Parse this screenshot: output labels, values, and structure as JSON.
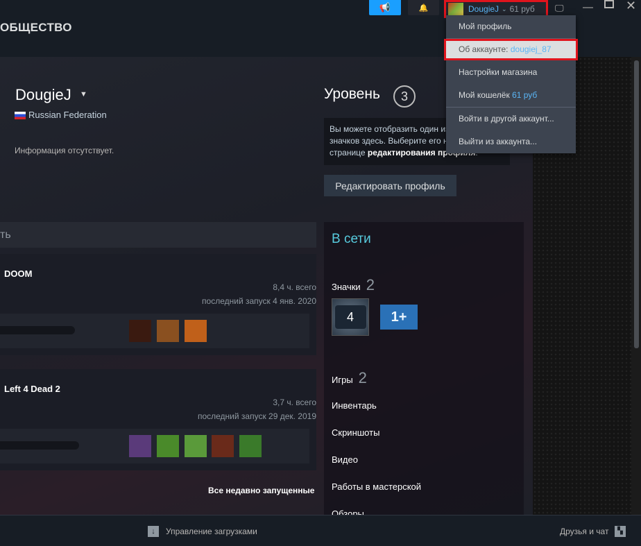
{
  "header": {
    "title": "ОБЩЕСТВО",
    "account_name": "DougieJ",
    "account_balance": "61 руб"
  },
  "menu": {
    "items": [
      {
        "label": "Мой профиль"
      },
      {
        "label": "Об аккаунте: ",
        "value": "dougiej_87"
      },
      {
        "label": "Настройки магазина"
      },
      {
        "label": "Мой кошелёк ",
        "value": "61 руб"
      },
      {
        "label": "Войти в другой аккаунт..."
      },
      {
        "label": "Выйти из аккаунта..."
      }
    ]
  },
  "profile": {
    "name": "DougieJ",
    "country": "Russian Federation",
    "info": "Информация отсутствует.",
    "level_label": "Уровень",
    "level": "3",
    "level_text1": "Вы можете отобразить один из своих",
    "level_text2": "значков здесь. Выберите его на",
    "level_text3": "странице ",
    "level_text_bold": "редактирования профиля",
    "level_text_end": ".",
    "edit_button": "Редактировать профиль"
  },
  "activity": {
    "header": "ть",
    "all_recent": "Все недавно запущенные",
    "games": [
      {
        "name": "DOOM",
        "hours": "8,4 ч. всего",
        "last": "последний запуск 4 янв. 2020",
        "achievements": [
          "#5a2210",
          "#8a5020",
          "#c0601a"
        ]
      },
      {
        "name": "Left 4 Dead 2",
        "hours": "3,7 ч. всего",
        "last": "последний запуск 29 дек. 2019",
        "achievements": [
          "#5a3a7a",
          "#4a8a2a",
          "#5a9a3a",
          "#6a2a1a",
          "#3a7a2a"
        ]
      }
    ]
  },
  "sidebar": {
    "status": "В сети",
    "badges_label": "Значки",
    "badges_count": "2",
    "badge1": "4",
    "badge2": "1+",
    "games_label": "Игры",
    "games_count": "2",
    "links": [
      "Инвентарь",
      "Скриншоты",
      "Видео",
      "Работы в мастерской",
      "Обзоры"
    ]
  },
  "footer": {
    "downloads": "Управление загрузками",
    "friends": "Друзья и чат"
  }
}
